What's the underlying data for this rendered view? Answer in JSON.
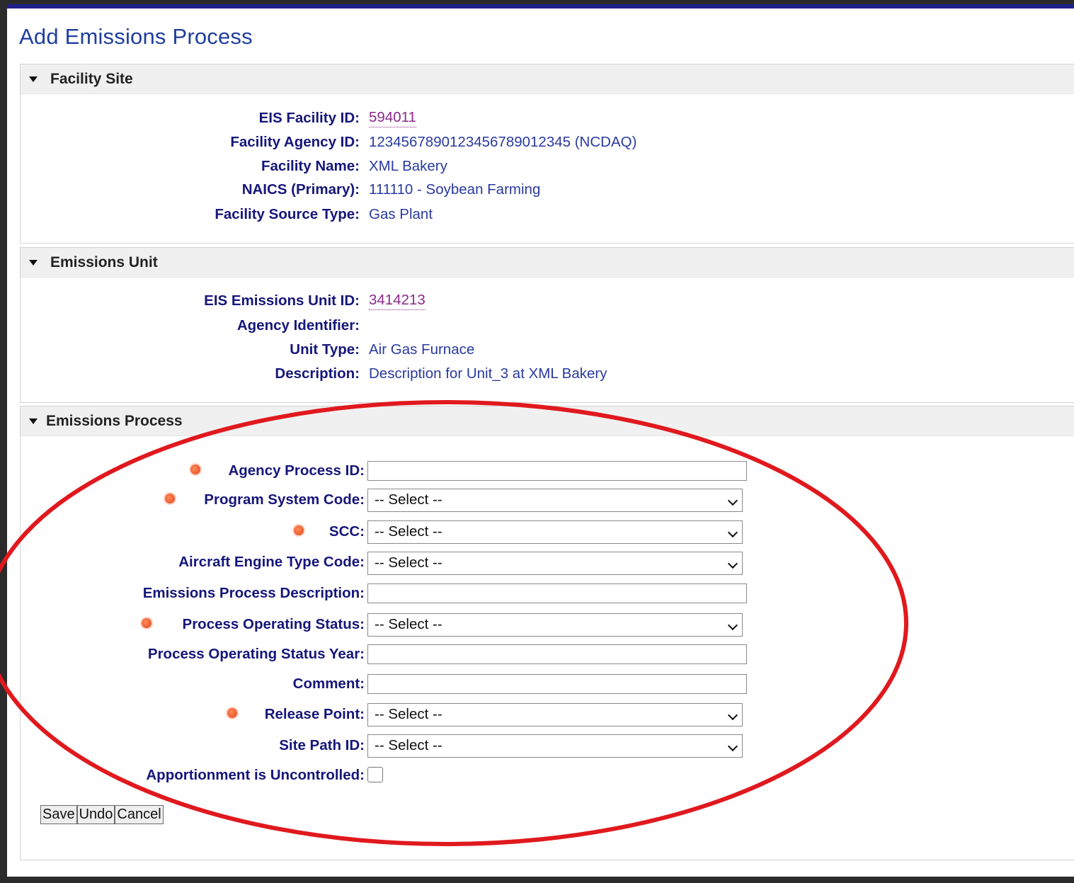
{
  "page": {
    "title": "Add Emissions Process"
  },
  "facility_site": {
    "header": "Facility Site",
    "rows": [
      {
        "label": "EIS Facility ID:",
        "value": "594011"
      },
      {
        "label": "Facility Agency ID:",
        "value": "12345678901234567890123​45 (NCDAQ)"
      },
      {
        "label": "Facility Name:",
        "value": "XML Bakery"
      },
      {
        "label": "NAICS (Primary):",
        "value": "111110 - Soybean Farming"
      },
      {
        "label": "Facility Source Type:",
        "value": "Gas Plant"
      }
    ]
  },
  "emissions_unit": {
    "header": "Emissions Unit",
    "rows": [
      {
        "label": "EIS Emissions Unit ID:",
        "value": "3414213"
      },
      {
        "label": "Agency Identifier:",
        "value": ""
      },
      {
        "label": "Unit Type:",
        "value": "Air Gas Furnace"
      },
      {
        "label": "Description:",
        "value": "Description for Unit_3 at XML Bakery"
      }
    ]
  },
  "emissions_process": {
    "header": "Emissions Process",
    "fields": {
      "agency_process_id": {
        "label": "Agency Process ID:",
        "value": ""
      },
      "program_system_code": {
        "label": "Program System Code:",
        "value": "-- Select --"
      },
      "scc": {
        "label": "SCC:",
        "value": "-- Select --"
      },
      "aircraft_engine_type_code": {
        "label": "Aircraft Engine Type Code:",
        "value": "-- Select --"
      },
      "emissions_process_description": {
        "label": "Emissions Process Description:",
        "value": ""
      },
      "process_operating_status": {
        "label": "Process Operating Status:",
        "value": "-- Select --"
      },
      "process_operating_status_year": {
        "label": "Process Operating Status Year:",
        "value": ""
      },
      "comment": {
        "label": "Comment:",
        "value": ""
      },
      "release_point": {
        "label": "Release Point:",
        "value": "-- Select --"
      },
      "site_path_id": {
        "label": "Site Path ID:",
        "value": "-- Select --"
      },
      "apportionment_uncontrolled": {
        "label": "Apportionment is Uncontrolled:",
        "checked": false
      }
    }
  },
  "buttons": {
    "save": "Save",
    "undo": "Undo",
    "cancel": "Cancel"
  },
  "colors": {
    "annotation": "#e0191e",
    "label": "#16167a",
    "link": "#8a2a8a",
    "required_marker": "#e0461e"
  }
}
